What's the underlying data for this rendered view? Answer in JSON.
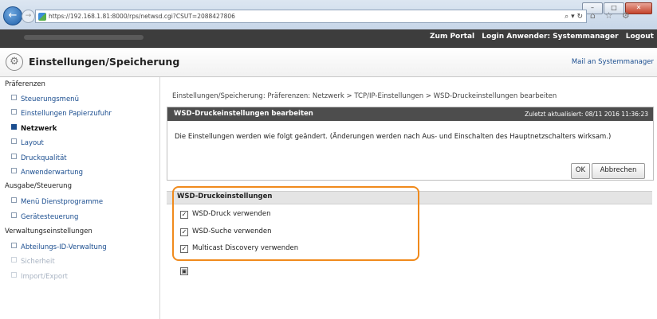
{
  "browser": {
    "url": "https://192.168.1.81:8000/rps/netwsd.cgi?CSUT=2088427806",
    "addr_controls": "⌕ ▾ ↻",
    "window_buttons": [
      "–",
      "□",
      "✕"
    ],
    "toolbar_icons": "⌂ ☆ ⚙"
  },
  "portal": {
    "links": [
      "Zum Portal",
      "Login Anwender: Systemmanager",
      "Logout"
    ]
  },
  "header": {
    "title": "Einstellungen/Speicherung",
    "mail_link": "Mail an Systemmanager"
  },
  "sidebar": {
    "sections": [
      {
        "label": "Präferenzen"
      },
      {
        "label": "Ausgabe/Steuerung"
      },
      {
        "label": "Verwaltungseinstellungen"
      }
    ],
    "items": [
      {
        "label": "Steuerungsmenü"
      },
      {
        "label": "Einstellungen Papierzufuhr"
      },
      {
        "label": "Netzwerk"
      },
      {
        "label": "Layout"
      },
      {
        "label": "Druckqualität"
      },
      {
        "label": "Anwenderwartung"
      },
      {
        "label": "Menü Dienstprogramme"
      },
      {
        "label": "Gerätesteuerung"
      },
      {
        "label": "Abteilungs-ID-Verwaltung"
      },
      {
        "label": "Sicherheit"
      },
      {
        "label": "Import/Export"
      }
    ],
    "active_item": "Netzwerk"
  },
  "main": {
    "breadcrumb": "Einstellungen/Speicherung: Präferenzen: Netzwerk > TCP/IP-Einstellungen > WSD-Druckeinstellungen bearbeiten",
    "panel": {
      "title": "WSD-Druckeinstellungen bearbeiten",
      "updated": "Zuletzt aktualisiert: 08/11 2016 11:36:23",
      "message": "Die Einstellungen werden wie folgt geändert. (Änderungen werden nach Aus- und Einschalten des Hauptnetzschalters wirksam.)",
      "ok_label": "OK",
      "cancel_label": "Abbrechen"
    },
    "section": {
      "title": "WSD-Druckeinstellungen",
      "options": [
        {
          "label": "WSD-Druck verwenden",
          "checked": true
        },
        {
          "label": "WSD-Suche verwenden",
          "checked": true
        },
        {
          "label": "Multicast Discovery verwenden",
          "checked": true
        }
      ]
    },
    "expand_icon": "▣"
  },
  "colors": {
    "accent_highlight": "#f08a1c",
    "link_blue": "#1a4d8f",
    "panel_header": "#4d4d4d",
    "portal_bar": "#3d3d3d"
  }
}
